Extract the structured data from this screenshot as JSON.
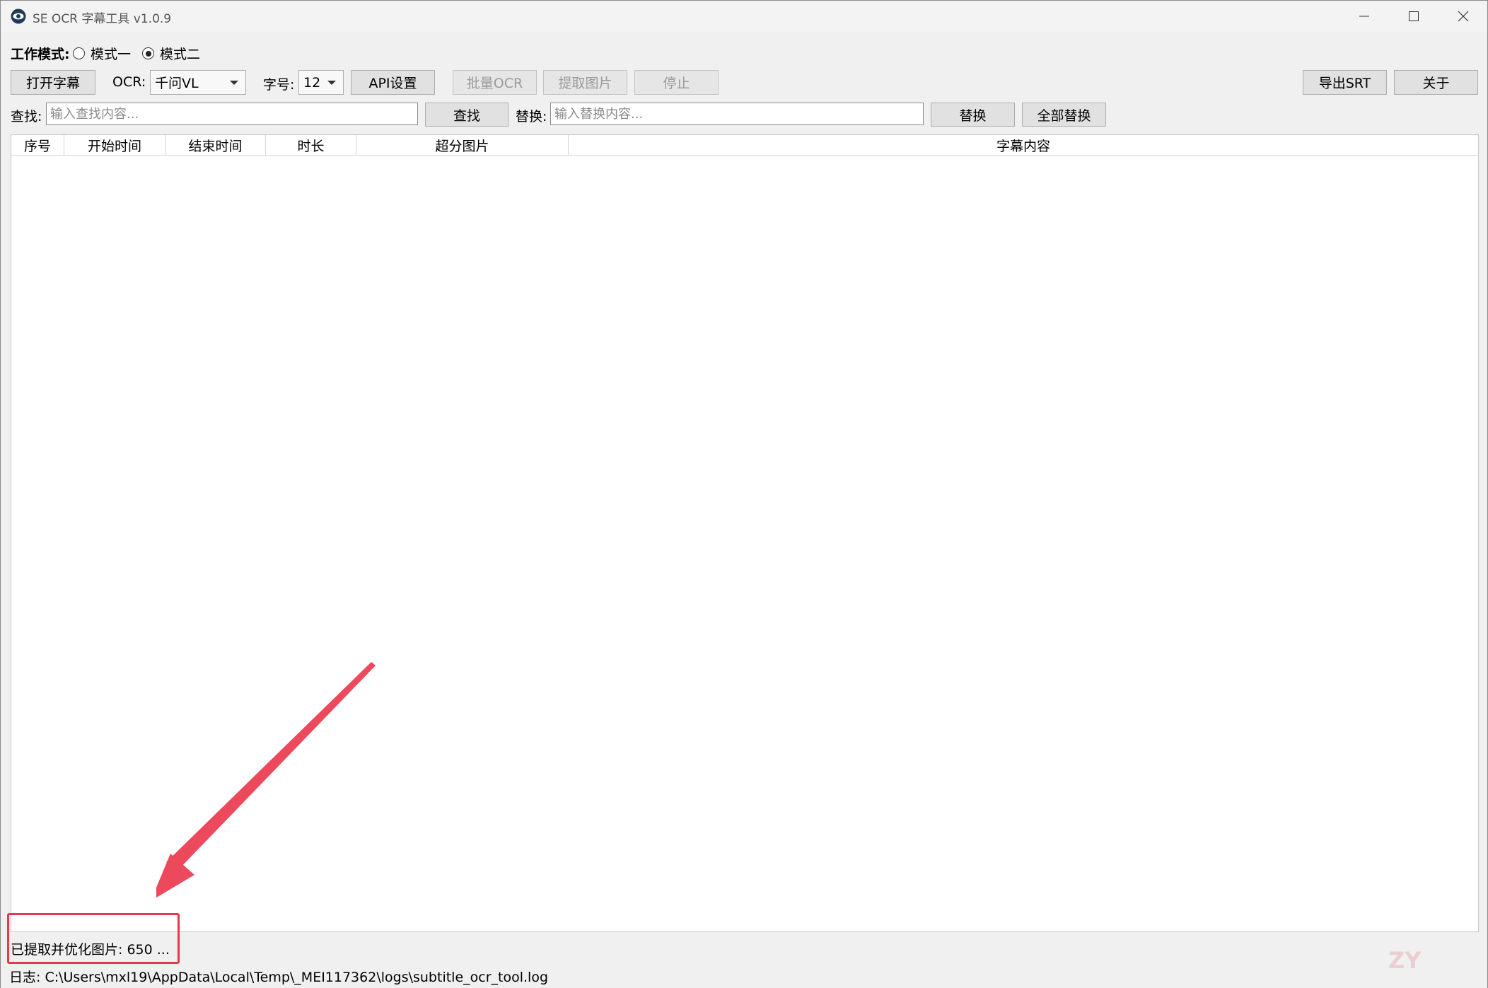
{
  "window": {
    "title": "SE OCR 字幕工具 v1.0.9"
  },
  "mode": {
    "label": "工作模式:",
    "options": [
      "模式一",
      "模式二"
    ],
    "selected": "模式二"
  },
  "toolbar": {
    "open_label": "打开字幕",
    "ocr_label": "OCR:",
    "ocr_value": "千问VL",
    "font_label": "字号:",
    "font_value": "12",
    "api_label": "API设置",
    "batch_label": "批量OCR",
    "extract_label": "提取图片",
    "stop_label": "停止",
    "export_label": "导出SRT",
    "about_label": "关于"
  },
  "search": {
    "find_label": "查找:",
    "find_placeholder": "输入查找内容...",
    "find_button": "查找",
    "replace_label": "替换:",
    "replace_placeholder": "输入替换内容...",
    "replace_button": "替换",
    "replace_all_button": "全部替换"
  },
  "table": {
    "columns": [
      "序号",
      "开始时间",
      "结束时间",
      "时长",
      "超分图片",
      "字幕内容"
    ]
  },
  "status": {
    "message": "已提取并优化图片: 650 ...",
    "log": "日志: C:\\Users\\mxl19\\AppData\\Local\\Temp\\_MEI117362\\logs\\subtitle_ocr_tool.log"
  },
  "colors": {
    "annotation": "#e33a4a"
  }
}
